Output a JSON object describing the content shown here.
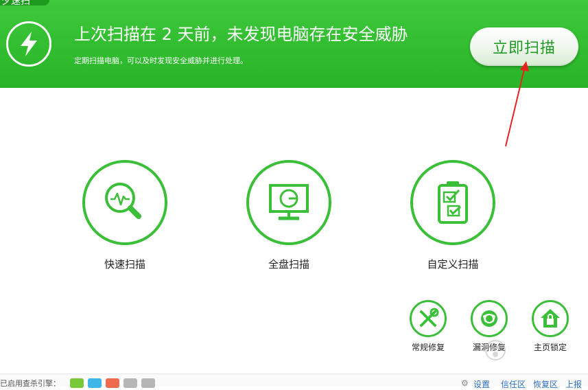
{
  "banner": {
    "corner_text": "夕速扫",
    "title": "上次扫描在 2 天前，未发现电脑存在安全威胁",
    "subtitle": "定期扫描电脑，可以及时发现安全威胁并进行处理。",
    "scan_now_label": "立即扫描",
    "colors": {
      "banner_green": "#2fbd2e",
      "accent_green": "#3bbf39",
      "arrow_red": "#e8231f"
    }
  },
  "scan_modes": [
    {
      "label": "快速扫描",
      "icon": "magnifier-pulse-icon"
    },
    {
      "label": "全盘扫描",
      "icon": "monitor-pie-icon"
    },
    {
      "label": "自定义扫描",
      "icon": "clipboard-check-icon"
    }
  ],
  "tools": [
    {
      "label": "常规修复",
      "icon": "wrench-screwdriver-icon"
    },
    {
      "label": "漏洞修复",
      "icon": "shield-globe-icon"
    },
    {
      "label": "主页锁定",
      "icon": "home-lock-icon"
    }
  ],
  "footer": {
    "engines_label": "已启用查杀引擎：",
    "links": [
      "设置",
      "信任区",
      "恢复区",
      "上报"
    ]
  }
}
